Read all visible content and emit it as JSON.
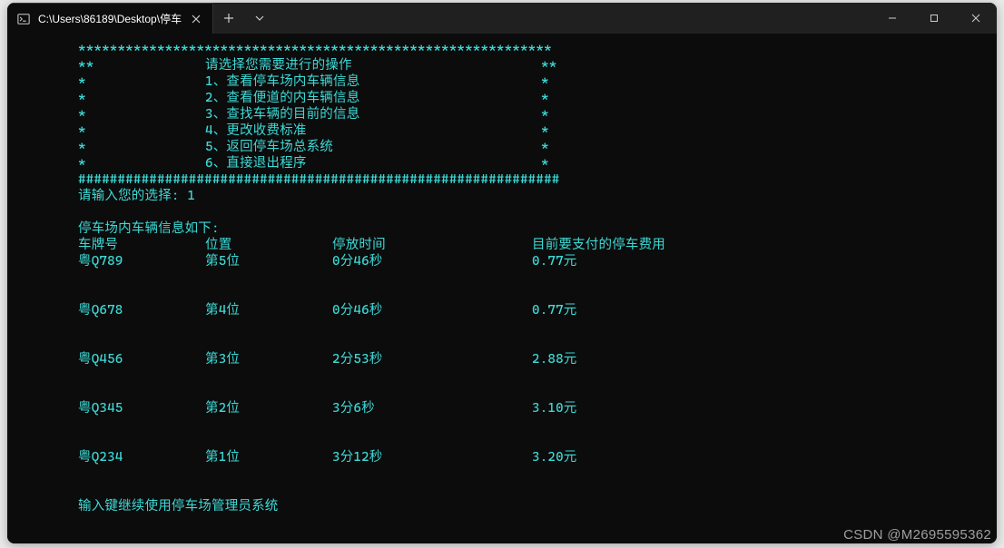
{
  "window": {
    "tab_title": "C:\\Users\\86189\\Desktop\\停车"
  },
  "menu": {
    "border_top": "************************************************************",
    "header_left": "**",
    "header_text": "请选择您需要进行的操作",
    "header_right": "**",
    "items": [
      {
        "left": "*",
        "text": "1、查看停车场内车辆信息",
        "right": "*"
      },
      {
        "left": "*",
        "text": "2、查看便道的内车辆信息",
        "right": "*"
      },
      {
        "left": "*",
        "text": "3、查找车辆的目前的信息",
        "right": "*"
      },
      {
        "left": "*",
        "text": "4、更改收费标准",
        "right": "*"
      },
      {
        "left": "*",
        "text": "5、返回停车场总系统",
        "right": "*"
      },
      {
        "left": "*",
        "text": "6、直接退出程序",
        "right": "*"
      }
    ],
    "border_bottom": "#############################################################"
  },
  "prompt": {
    "label": "请输入您的选择:",
    "value": "1"
  },
  "table": {
    "title": "停车场内车辆信息如下:",
    "headers": {
      "plate": "车牌号",
      "position": "位置",
      "duration": "停放时间",
      "fee": "目前要支付的停车费用"
    },
    "rows": [
      {
        "plate": "粤Q789",
        "position": "第5位",
        "duration": "0分46秒",
        "fee": "0.77元"
      },
      {
        "plate": "粤Q678",
        "position": "第4位",
        "duration": "0分46秒",
        "fee": "0.77元"
      },
      {
        "plate": "粤Q456",
        "position": "第3位",
        "duration": "2分53秒",
        "fee": "2.88元"
      },
      {
        "plate": "粤Q345",
        "position": "第2位",
        "duration": "3分6秒",
        "fee": "3.10元"
      },
      {
        "plate": "粤Q234",
        "position": "第1位",
        "duration": "3分12秒",
        "fee": "3.20元"
      }
    ]
  },
  "footer": {
    "continue_prompt": "输入键继续使用停车场管理员系统"
  },
  "watermark": "CSDN @M2695595362"
}
